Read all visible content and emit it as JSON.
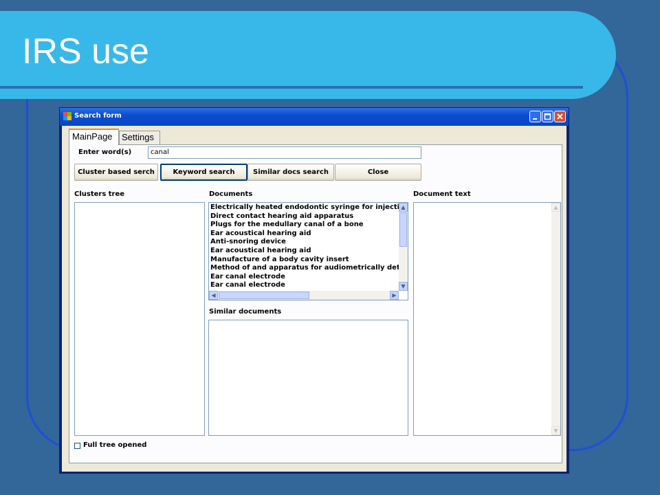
{
  "slide": {
    "title": "IRS use"
  },
  "window": {
    "title": "Search form",
    "controls": {
      "minimize": "_",
      "maximize": "□",
      "close": "✕"
    }
  },
  "tabs": [
    {
      "label": "MainPage",
      "active": true
    },
    {
      "label": "Settings",
      "active": false
    }
  ],
  "search": {
    "label": "Enter word(s)",
    "value": "canal"
  },
  "buttons": {
    "cluster": "Cluster based serch",
    "keyword": "Keyword search",
    "similar": "Similar docs search",
    "close": "Close"
  },
  "panels": {
    "clusters_tree": "Clusters tree",
    "documents": "Documents",
    "similar_documents": "Similar documents",
    "document_text": "Document text"
  },
  "documents": [
    "Electrically heated endodontic syringe for injecting th",
    "Direct contact hearing aid apparatus",
    "Plugs for the medullary canal of a bone",
    "Ear acoustical hearing aid",
    "Anti-snoring device",
    "Ear acoustical hearing aid",
    "Manufacture of a body cavity insert",
    "Method of and apparatus for audiometrically determi",
    "Ear canal electrode",
    "Ear canal electrode"
  ],
  "checkbox": {
    "label": "Full tree opened",
    "checked": false
  },
  "colors": {
    "background": "#336699",
    "title_band": "#38b8e8",
    "window_titlebar": "#0a4ed0"
  },
  "icons": {
    "scroll_up": "▲",
    "scroll_down": "▼",
    "scroll_left": "◀",
    "scroll_right": "▶"
  }
}
